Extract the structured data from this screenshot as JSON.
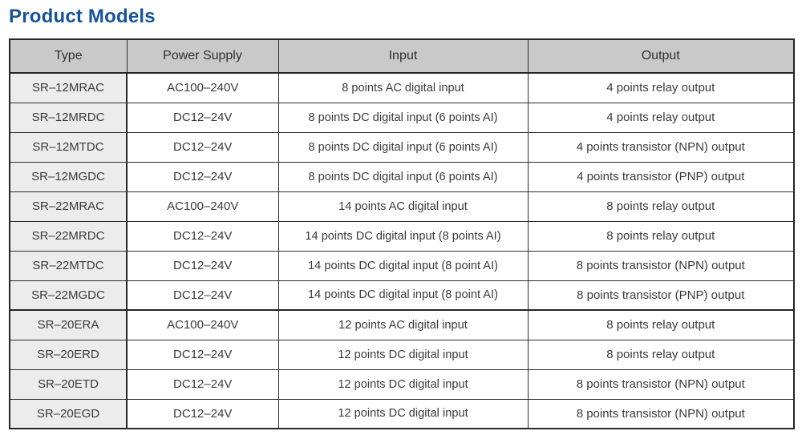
{
  "title": "Product Models",
  "colors": {
    "title": "#16539b",
    "header_bg": "#c9c9c9",
    "type_col_bg": "#ececec",
    "border": "#262626",
    "text": "#3a3a3a"
  },
  "table": {
    "columns": [
      "Type",
      "Power Supply",
      "Input",
      "Output"
    ],
    "rows": [
      {
        "type": "SR‒12MRAC",
        "power": "AC100‒240V",
        "input": "8 points AC digital input",
        "output": "4 points relay output",
        "group_break": false
      },
      {
        "type": "SR‒12MRDC",
        "power": "DC12‒24V",
        "input": "8 points DC digital input (6 points AI)",
        "output": "4 points relay output",
        "group_break": false
      },
      {
        "type": "SR‒12MTDC",
        "power": "DC12‒24V",
        "input": "8 points DC digital input (6 points AI)",
        "output": "4 points transistor (NPN) output",
        "group_break": false
      },
      {
        "type": "SR‒12MGDC",
        "power": "DC12‒24V",
        "input": "8 points DC digital input (6 points AI)",
        "output": "4 points transistor (PNP) output",
        "group_break": false
      },
      {
        "type": "SR‒22MRAC",
        "power": "AC100‒240V",
        "input": "14 points AC digital input",
        "output": "8 points relay output",
        "group_break": false
      },
      {
        "type": "SR‒22MRDC",
        "power": "DC12‒24V",
        "input": "14 points DC digital input (8 points AI)",
        "output": "8 points relay output",
        "group_break": false
      },
      {
        "type": "SR‒22MTDC",
        "power": "DC12‒24V",
        "input": "14 points DC digital input (8 point AI)",
        "output": "8 points transistor (NPN) output",
        "group_break": false
      },
      {
        "type": "SR‒22MGDC",
        "power": "DC12‒24V",
        "input": "14 points DC digital input (8 point AI)",
        "output": "8 points transistor (PNP) output",
        "group_break": false
      },
      {
        "type": "SR‒20ERA",
        "power": "AC100‒240V",
        "input": "12 points AC digital input",
        "output": "8 points relay output",
        "group_break": true
      },
      {
        "type": "SR‒20ERD",
        "power": "DC12‒24V",
        "input": "12 points DC digital input",
        "output": "8 points relay output",
        "group_break": false
      },
      {
        "type": "SR‒20ETD",
        "power": "DC12‒24V",
        "input": "12 points DC digital input",
        "output": "8 points transistor (NPN) output",
        "group_break": false
      },
      {
        "type": "SR‒20EGD",
        "power": "DC12‒24V",
        "input": "12 points DC digital input",
        "output": "8 points transistor (NPN) output",
        "group_break": false
      }
    ]
  }
}
